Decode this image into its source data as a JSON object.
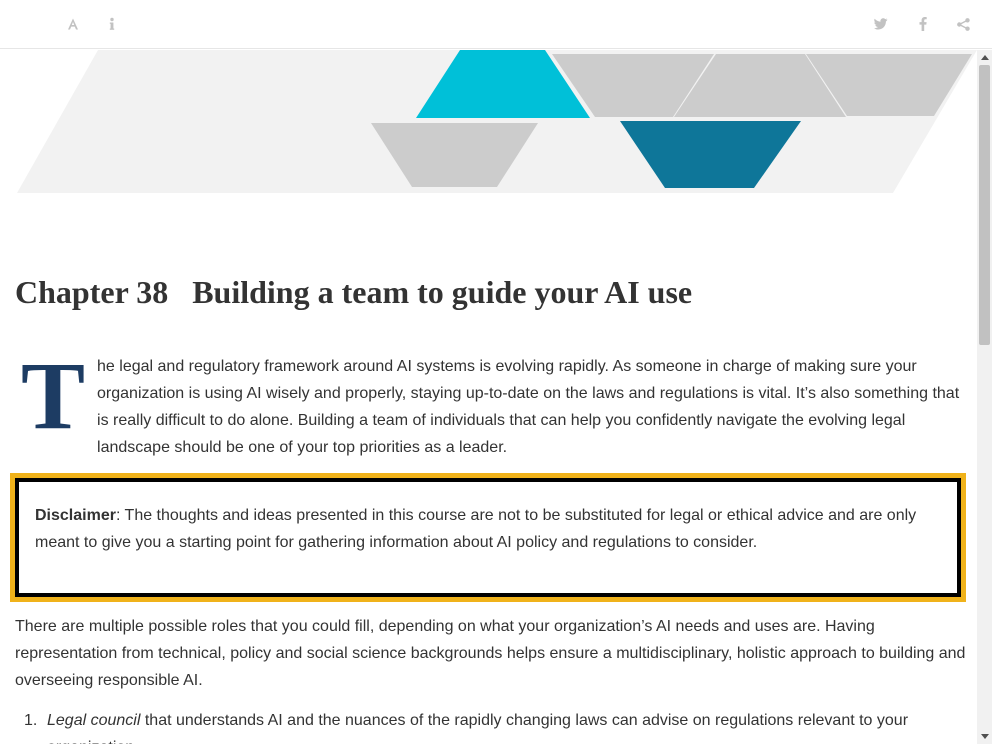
{
  "toolbar": {
    "left_icons": [
      "font-size-icon",
      "info-icon"
    ],
    "right_icons": [
      "twitter-icon",
      "facebook-icon",
      "share-icon"
    ]
  },
  "banner": {
    "colors": {
      "light_gray": "#f2f2f2",
      "mid_gray": "#cccccc",
      "cyan": "#00c0d8",
      "teal": "#0e7699"
    }
  },
  "chapter": {
    "number": "Chapter 38",
    "title": "Building a team to guide your AI use"
  },
  "intro": {
    "drop_cap": "T",
    "text": "he legal and regulatory framework around AI systems is evolving rapidly. As someone in charge of making sure your organization is using AI wisely and properly, staying up-to-date on the laws and regulations is vital. It’s also something that is really difficult to do alone. Building a team of individuals that can help you confidently navigate the evolving legal landscape should be one of your top priorities as a leader."
  },
  "disclaimer": {
    "label": "Disclaimer",
    "text": ": The thoughts and ideas presented in this course are not to be substituted for legal or ethical advice and are only meant to give you a starting point for gathering information about AI policy and regulations to consider.",
    "border_color": "#f0b21a"
  },
  "paragraph2": "There are multiple possible roles that you could fill, depending on what your organization’s AI needs and uses are. Having representation from technical, policy and social science backgrounds helps ensure a multidisciplinary, holistic approach to building and overseeing responsible AI.",
  "list": [
    {
      "marker": "1.",
      "term": "Legal council",
      "text": " that understands AI and the nuances of the rapidly changing laws can advise on regulations relevant to your organization."
    }
  ],
  "colors": {
    "drop_cap": "#1d3c63",
    "text": "#333333",
    "toolbar_icon": "#c2c2c2"
  }
}
